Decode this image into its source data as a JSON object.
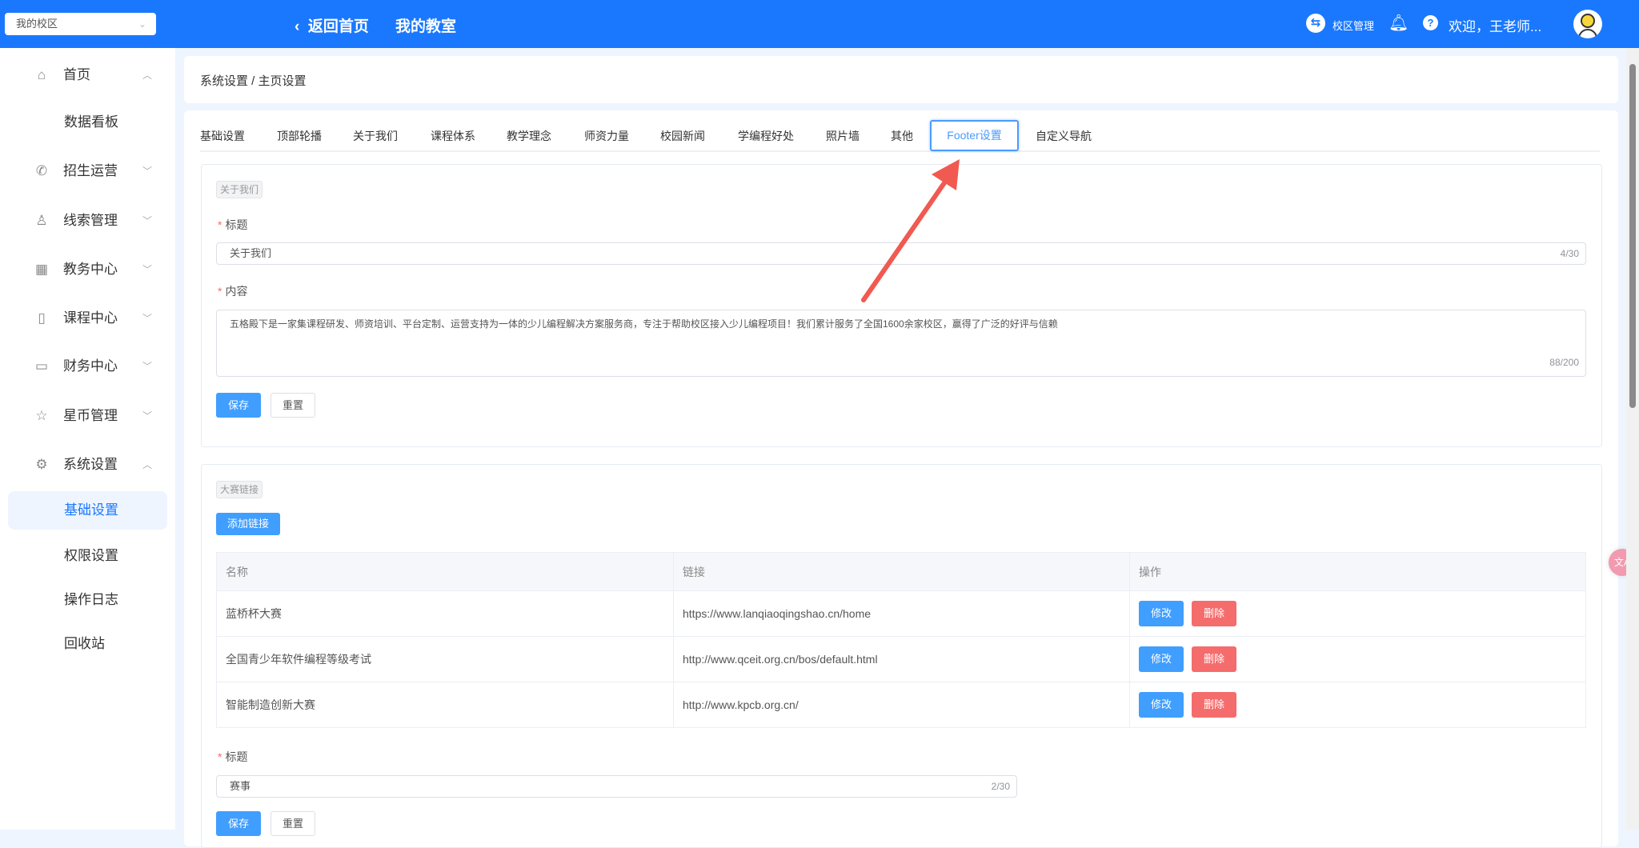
{
  "header": {
    "campus_select": "我的校区",
    "back_home": "返回首页",
    "my_classroom": "我的教室",
    "campus_manage": "校区管理",
    "welcome": "欢迎，王老师...",
    "colors": {
      "primary": "#1a78ff"
    }
  },
  "sidebar": {
    "items": [
      {
        "label": "首页",
        "icon": "home-icon",
        "chevron": "up"
      },
      {
        "label": "数据看板",
        "sub": true
      },
      {
        "label": "招生运营",
        "icon": "phone-icon",
        "chevron": "down"
      },
      {
        "label": "线索管理",
        "icon": "user-icon",
        "chevron": "down"
      },
      {
        "label": "教务中心",
        "icon": "building-icon",
        "chevron": "down"
      },
      {
        "label": "课程中心",
        "icon": "notebook-icon",
        "chevron": "down"
      },
      {
        "label": "财务中心",
        "icon": "card-icon",
        "chevron": "down"
      },
      {
        "label": "星币管理",
        "icon": "star-icon",
        "chevron": "down"
      },
      {
        "label": "系统设置",
        "icon": "gear-icon",
        "chevron": "up"
      },
      {
        "label": "基础设置",
        "sub": true,
        "active": true
      },
      {
        "label": "权限设置",
        "sub": true
      },
      {
        "label": "操作日志",
        "sub": true
      },
      {
        "label": "回收站",
        "sub": true
      }
    ]
  },
  "breadcrumb": "系统设置 / 主页设置",
  "tabs": [
    "基础设置",
    "顶部轮播",
    "关于我们",
    "课程体系",
    "教学理念",
    "师资力量",
    "校园新闻",
    "学编程好处",
    "照片墙",
    "其他",
    "Footer设置",
    "自定义导航"
  ],
  "active_tab": "Footer设置",
  "about": {
    "tag": "关于我们",
    "title_label": "标题",
    "title_value": "关于我们",
    "title_count": "4/30",
    "content_label": "内容",
    "content_value": "五格殿下是一家集课程研发、师资培训、平台定制、运营支持为一体的少儿编程解决方案服务商，专注于帮助校区接入少儿编程项目！我们累计服务了全国1600余家校区，赢得了广泛的好评与信赖",
    "content_count": "88/200",
    "save": "保存",
    "reset": "重置"
  },
  "contest": {
    "tag": "大赛链接",
    "add_button": "添加链接",
    "columns": [
      "名称",
      "链接",
      "操作"
    ],
    "rows": [
      {
        "name": "蓝桥杯大赛",
        "link": "https://www.lanqiaoqingshao.cn/home"
      },
      {
        "name": "全国青少年软件编程等级考试",
        "link": "http://www.qceit.org.cn/bos/default.html"
      },
      {
        "name": "智能制造创新大赛",
        "link": "http://www.kpcb.org.cn/"
      }
    ],
    "edit": "修改",
    "delete": "删除",
    "title_label": "标题",
    "title_value": "赛事",
    "title_count": "2/30",
    "save": "保存",
    "reset": "重置"
  }
}
